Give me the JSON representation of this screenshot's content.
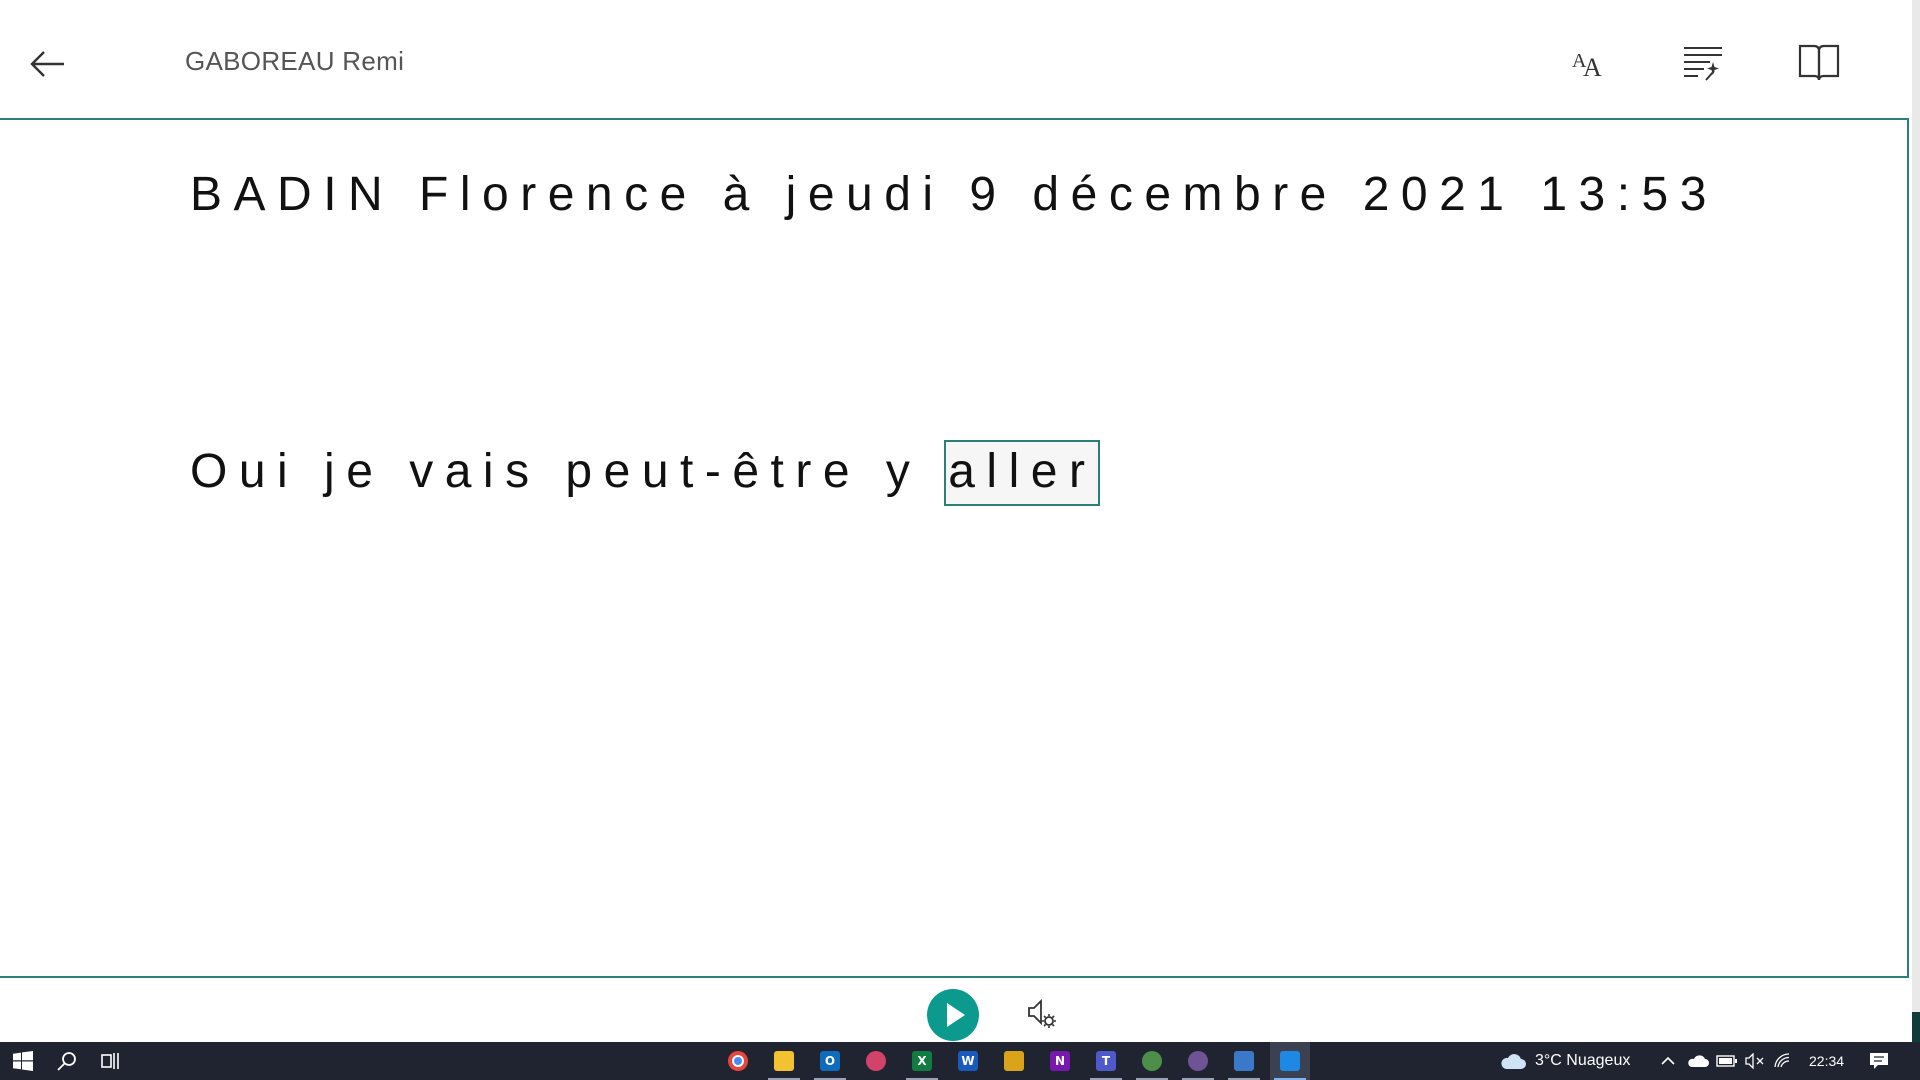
{
  "header": {
    "title": "GABOREAU Remi",
    "icons": [
      "back-arrow-icon",
      "text-preferences-icon",
      "grammar-options-icon",
      "reading-preferences-icon"
    ]
  },
  "reader": {
    "line1": "BADIN Florence à jeudi 9 décembre 2021 13:53",
    "line2_prefix": "Oui je vais peut-être y ",
    "line2_focus_word": "aller"
  },
  "controls": {
    "play": "play-icon",
    "voice_settings": "voice-settings-icon"
  },
  "colors": {
    "accent": "#0c9a8e",
    "border": "#2a8079",
    "taskbar": "#1f2430"
  },
  "taskbar": {
    "apps": [
      {
        "name": "chrome",
        "glyph": "",
        "color": "#e8453c"
      },
      {
        "name": "file-explorer",
        "glyph": "",
        "color": "#f2c230"
      },
      {
        "name": "outlook",
        "glyph": "O",
        "color": "#0f6cbd"
      },
      {
        "name": "paint",
        "glyph": "",
        "color": "#d2426a"
      },
      {
        "name": "excel",
        "glyph": "X",
        "color": "#107c41"
      },
      {
        "name": "word",
        "glyph": "W",
        "color": "#185abd"
      },
      {
        "name": "photo-app",
        "glyph": "",
        "color": "#d9a31a"
      },
      {
        "name": "onenote",
        "glyph": "N",
        "color": "#7719aa"
      },
      {
        "name": "teams",
        "glyph": "T",
        "color": "#5059c9"
      },
      {
        "name": "chrome-2",
        "glyph": "",
        "color": "#4d8f4a"
      },
      {
        "name": "github",
        "glyph": "",
        "color": "#6e5494"
      },
      {
        "name": "image-viewer",
        "glyph": "",
        "color": "#3a79c9"
      },
      {
        "name": "vscode",
        "glyph": "",
        "color": "#1e88e5"
      }
    ],
    "weather": "3°C  Nuageux",
    "time": "22:34"
  }
}
